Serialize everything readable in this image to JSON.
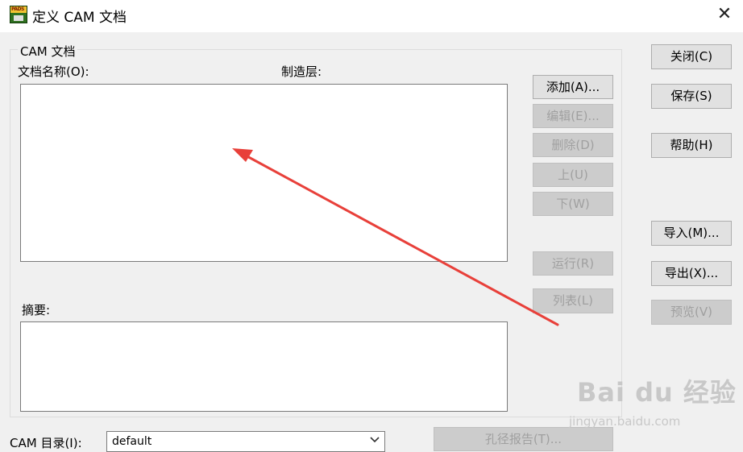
{
  "window": {
    "title": "定义 CAM 文档",
    "app_icon_text": "PADS"
  },
  "group": {
    "legend": "CAM 文档",
    "doc_name_label": "文档名称(O):",
    "layer_label": "制造层:",
    "summary_label": "摘要:"
  },
  "middle_buttons": [
    {
      "label": "添加(A)...",
      "enabled": true
    },
    {
      "label": "编辑(E)...",
      "enabled": false
    },
    {
      "label": "删除(D)",
      "enabled": false
    },
    {
      "label": "上(U)",
      "enabled": false
    },
    {
      "label": "下(W)",
      "enabled": false
    },
    {
      "label": "运行(R)",
      "enabled": false
    },
    {
      "label": "列表(L)",
      "enabled": false
    }
  ],
  "right_buttons": [
    {
      "label": "关闭(C)",
      "enabled": true
    },
    {
      "label": "保存(S)",
      "enabled": true
    },
    {
      "label": "帮助(H)",
      "enabled": true
    },
    {
      "label": "导入(M)...",
      "enabled": true
    },
    {
      "label": "导出(X)...",
      "enabled": true
    },
    {
      "label": "预览(V)",
      "enabled": false
    }
  ],
  "bottom": {
    "dir_label": "CAM 目录(I):",
    "dir_value": "default",
    "hole_report_label": "孔径报告(T)..."
  },
  "annotation": {
    "arrow_color": "#e8403a"
  },
  "watermark": {
    "brand": "Bai du 经验",
    "url": "jingyan.baidu.com"
  }
}
